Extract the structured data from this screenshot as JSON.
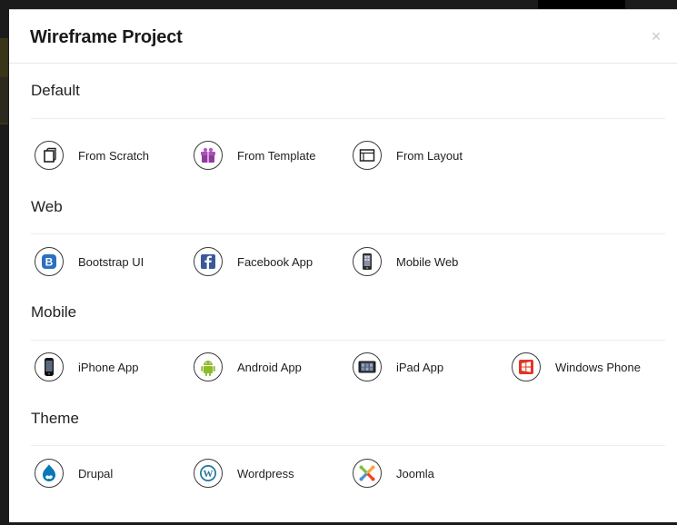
{
  "modal": {
    "title": "Wireframe Project",
    "close_glyph": "×"
  },
  "sections": [
    {
      "title": "Default",
      "options": [
        {
          "label": "From Scratch",
          "icon": "page-icon"
        },
        {
          "label": "From Template",
          "icon": "gift-box-icon"
        },
        {
          "label": "From Layout",
          "icon": "layout-icon"
        }
      ]
    },
    {
      "title": "Web",
      "options": [
        {
          "label": "Bootstrap UI",
          "icon": "bootstrap-icon"
        },
        {
          "label": "Facebook App",
          "icon": "facebook-icon"
        },
        {
          "label": "Mobile Web",
          "icon": "mobile-icon"
        }
      ]
    },
    {
      "title": "Mobile",
      "options": [
        {
          "label": "iPhone App",
          "icon": "iphone-icon"
        },
        {
          "label": "Android App",
          "icon": "android-icon"
        },
        {
          "label": "iPad App",
          "icon": "ipad-icon"
        },
        {
          "label": "Windows Phone",
          "icon": "windows-icon"
        }
      ]
    },
    {
      "title": "Theme",
      "options": [
        {
          "label": "Drupal",
          "icon": "drupal-icon"
        },
        {
          "label": "Wordpress",
          "icon": "wordpress-icon"
        },
        {
          "label": "Joomla",
          "icon": "joomla-icon"
        }
      ]
    }
  ],
  "colors": {
    "bootstrap": "#2b6fc0",
    "facebook": "#3b5998",
    "android": "#8dbb29",
    "windows": "#e23524",
    "drupal": "#0a77b8",
    "wordpress": "#21759b",
    "template": "#8e3c9a"
  }
}
